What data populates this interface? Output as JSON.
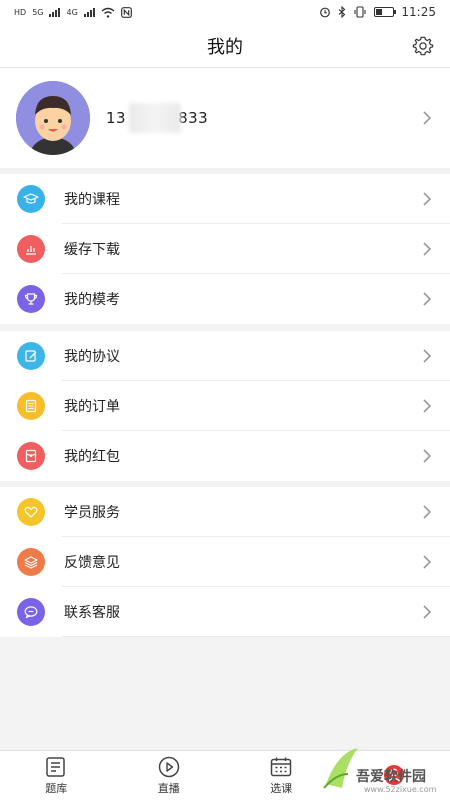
{
  "status_bar": {
    "network_left": "HD",
    "net_type_1": "5G",
    "net_type_2": "4G",
    "time": "11:25"
  },
  "header": {
    "title": "我的",
    "settings_icon": "gear-icon"
  },
  "profile": {
    "phone_prefix": "13",
    "phone_suffix": "833"
  },
  "groups": [
    {
      "items": [
        {
          "label": "我的课程",
          "icon": "graduation-cap-icon",
          "color": "#38b2e8"
        },
        {
          "label": "缓存下载",
          "icon": "bar-chart-icon",
          "color": "#ef5f5f"
        },
        {
          "label": "我的模考",
          "icon": "trophy-icon",
          "color": "#7a63e6"
        }
      ]
    },
    {
      "items": [
        {
          "label": "我的协议",
          "icon": "edit-document-icon",
          "color": "#3cb6e8"
        },
        {
          "label": "我的订单",
          "icon": "list-document-icon",
          "color": "#f6bf2a"
        },
        {
          "label": "我的红包",
          "icon": "red-packet-icon",
          "color": "#ef5f5f"
        }
      ]
    },
    {
      "items": [
        {
          "label": "学员服务",
          "icon": "heart-icon",
          "color": "#f6c52c"
        },
        {
          "label": "反馈意见",
          "icon": "stack-icon",
          "color": "#ee7a4a"
        },
        {
          "label": "联系客服",
          "icon": "chat-bubble-icon",
          "color": "#7a63e6"
        }
      ]
    }
  ],
  "tabbar": {
    "tabs": [
      {
        "label": "题库",
        "icon": "question-bank-icon"
      },
      {
        "label": "直播",
        "icon": "play-circle-icon"
      },
      {
        "label": "选课",
        "icon": "calendar-icon"
      },
      {
        "label": "",
        "icon": "profile-icon"
      }
    ]
  },
  "watermark": {
    "brand": "吾爱软件园",
    "url": "www.52zixue.com"
  }
}
